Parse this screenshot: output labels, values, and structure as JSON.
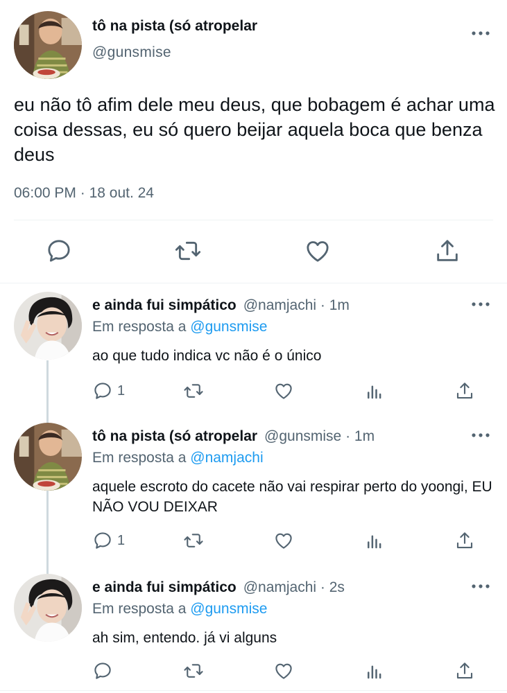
{
  "main_tweet": {
    "author_name": "tô na pista (só atropelar",
    "author_handle": "@gunsmise",
    "text": "eu não tô afim dele meu deus, que bobagem é achar uma coisa dessas, eu só quero beijar aquela boca que benza deus",
    "time": "06:00 PM",
    "separator": "·",
    "date": "18 out. 24",
    "icons": [
      "reply-icon",
      "retweet-icon",
      "like-icon",
      "share-icon"
    ]
  },
  "replies": [
    {
      "author_name": "e ainda fui simpático",
      "author_handle": "@namjachi",
      "time": "· 1m",
      "replying_prefix": "Em resposta a",
      "replying_to": "@gunsmise",
      "text": "ao que tudo indica vc não é o único",
      "reply_count": "1"
    },
    {
      "author_name": "tô na pista (só atropelar",
      "author_handle": "@gunsmise",
      "time": "· 1m",
      "replying_prefix": "Em resposta a",
      "replying_to": "@namjachi",
      "text": "aquele escroto do cacete não vai respirar perto do yoongi, EU NÃO VOU DEIXAR",
      "reply_count": "1"
    },
    {
      "author_name": "e ainda fui simpático",
      "author_handle": "@namjachi",
      "time": "· 2s",
      "replying_prefix": "Em resposta a",
      "replying_to": "@gunsmise",
      "text": "ah sim, entendo. já vi alguns",
      "reply_count": ""
    }
  ],
  "colors": {
    "text": "#0f1419",
    "muted": "#536471",
    "link": "#1d9bf0",
    "divider": "#eff3f4"
  }
}
